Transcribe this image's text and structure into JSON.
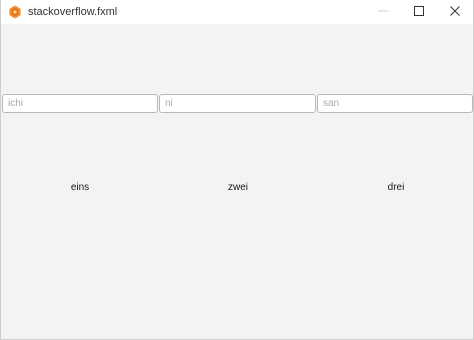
{
  "window": {
    "title": "stackoverflow.fxml",
    "icon": "javafx-app-icon",
    "controls": {
      "minimize_icon": "minimize-icon",
      "maximize_icon": "maximize-icon",
      "close_icon": "close-icon"
    }
  },
  "fields": [
    {
      "placeholder": "ichi",
      "value": ""
    },
    {
      "placeholder": "ni",
      "value": ""
    },
    {
      "placeholder": "san",
      "value": ""
    }
  ],
  "labels": [
    {
      "text": "eins"
    },
    {
      "text": "zwei"
    },
    {
      "text": "drei"
    }
  ],
  "colors": {
    "content_background": "#f3f3f3",
    "titlebar_background": "#ffffff",
    "app_icon_orange": "#f0922c"
  }
}
